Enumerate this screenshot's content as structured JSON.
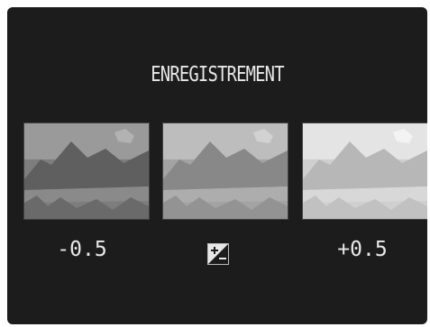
{
  "screen": {
    "title": "ENREGISTREMENT",
    "options": [
      {
        "label": "-0.5"
      },
      {
        "label": ""
      },
      {
        "label": "+0.5"
      }
    ],
    "center_icon": "exposure-compensation-icon"
  },
  "colors": {
    "background": "#1c1c1c",
    "text": "#e8e8e8"
  }
}
